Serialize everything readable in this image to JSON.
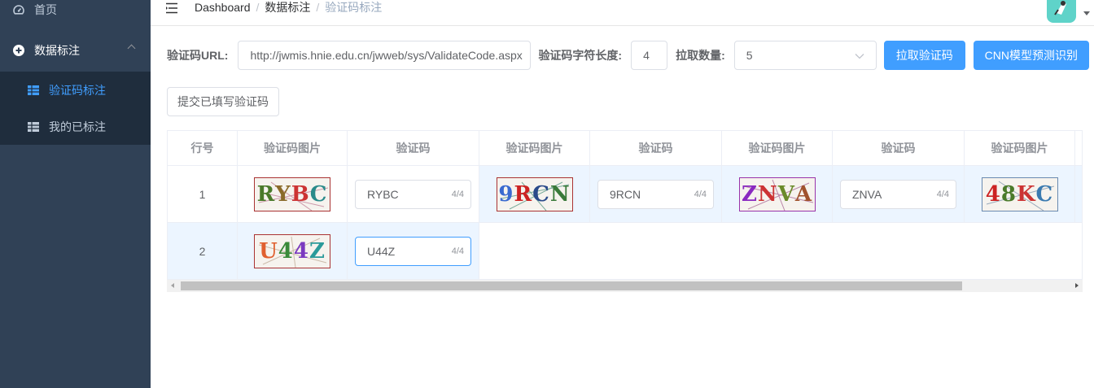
{
  "sidebar": {
    "home_label": "首页",
    "data_label": "数据标注",
    "sub_items": [
      {
        "label": "验证码标注",
        "active": true
      },
      {
        "label": "我的已标注",
        "active": false
      }
    ]
  },
  "breadcrumb": [
    "Dashboard",
    "数据标注",
    "验证码标注"
  ],
  "form": {
    "url_label": "验证码URL:",
    "url_value": "http://jwmis.hnie.edu.cn/jwweb/sys/ValidateCode.aspx",
    "length_label": "验证码字符长度:",
    "length_value": "4",
    "count_label": "拉取数量:",
    "count_value": "5",
    "fetch_button": "拉取验证码",
    "cnn_button": "CNN模型预测识别",
    "submit_button": "提交已填写验证码"
  },
  "table": {
    "headers": {
      "row_no": "行号",
      "image": "验证码图片",
      "code": "验证码"
    },
    "rows": [
      {
        "no": "1",
        "cells": [
          {
            "image_text": "RYBC",
            "value": "RYBC",
            "count": "4/4"
          },
          {
            "image_text": "9RCN",
            "value": "9RCN",
            "count": "4/4"
          },
          {
            "image_text": "ZNVA",
            "value": "ZNVA",
            "count": "4/4"
          },
          {
            "image_text": "48KC"
          }
        ]
      },
      {
        "no": "2",
        "cells": [
          {
            "image_text": "U44Z",
            "value": "U44Z",
            "count": "4/4"
          }
        ]
      }
    ]
  },
  "colors": {
    "sidebar_bg": "#304156",
    "submenu_bg": "#1f2d3d",
    "primary": "#409eff",
    "row_highlight": "#ecf5ff"
  }
}
